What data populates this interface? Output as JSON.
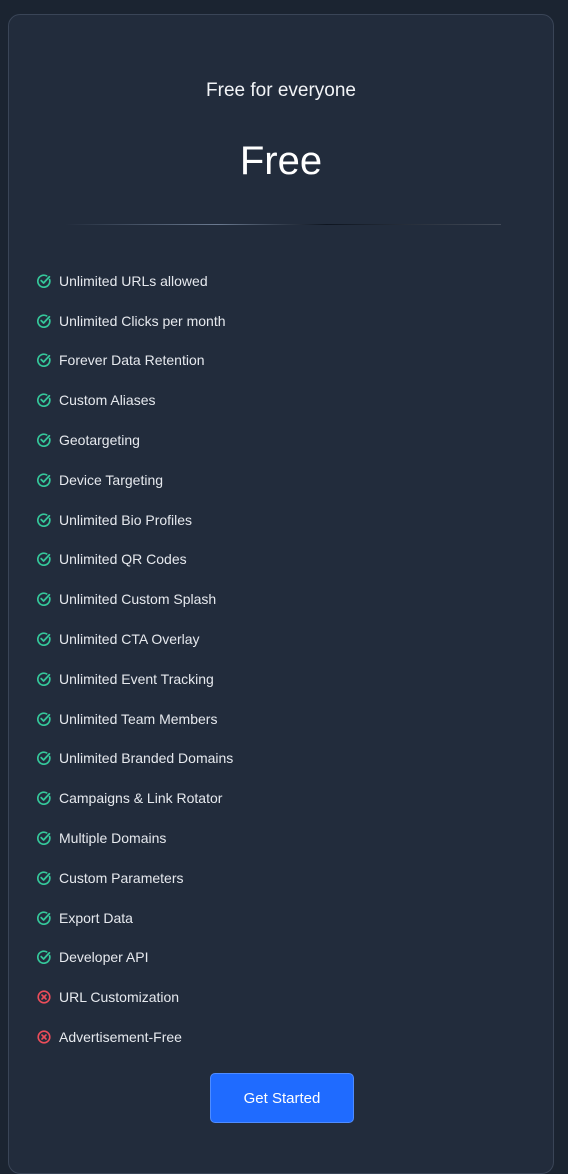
{
  "plan": {
    "subtitle": "Free for everyone",
    "price": "Free"
  },
  "colors": {
    "included": "#35c79a",
    "excluded": "#ec4d5a",
    "button": "#1f6bff"
  },
  "features": [
    {
      "label": "Unlimited URLs allowed",
      "included": true,
      "icon": "check-circle-icon"
    },
    {
      "label": "Unlimited Clicks per month",
      "included": true,
      "icon": "check-circle-icon"
    },
    {
      "label": "Forever Data Retention",
      "included": true,
      "icon": "check-circle-icon"
    },
    {
      "label": "Custom Aliases",
      "included": true,
      "icon": "check-circle-icon"
    },
    {
      "label": "Geotargeting",
      "included": true,
      "icon": "check-circle-icon"
    },
    {
      "label": "Device Targeting",
      "included": true,
      "icon": "check-circle-icon"
    },
    {
      "label": "Unlimited Bio Profiles",
      "included": true,
      "icon": "check-circle-icon"
    },
    {
      "label": "Unlimited QR Codes",
      "included": true,
      "icon": "check-circle-icon"
    },
    {
      "label": "Unlimited Custom Splash",
      "included": true,
      "icon": "check-circle-icon"
    },
    {
      "label": "Unlimited CTA Overlay",
      "included": true,
      "icon": "check-circle-icon"
    },
    {
      "label": "Unlimited Event Tracking",
      "included": true,
      "icon": "check-circle-icon"
    },
    {
      "label": "Unlimited Team Members",
      "included": true,
      "icon": "check-circle-icon"
    },
    {
      "label": "Unlimited Branded Domains",
      "included": true,
      "icon": "check-circle-icon"
    },
    {
      "label": "Campaigns & Link Rotator",
      "included": true,
      "icon": "check-circle-icon"
    },
    {
      "label": "Multiple Domains",
      "included": true,
      "icon": "check-circle-icon"
    },
    {
      "label": "Custom Parameters",
      "included": true,
      "icon": "check-circle-icon"
    },
    {
      "label": "Export Data",
      "included": true,
      "icon": "check-circle-icon"
    },
    {
      "label": "Developer API",
      "included": true,
      "icon": "check-circle-icon"
    },
    {
      "label": "URL Customization",
      "included": false,
      "icon": "x-circle-icon"
    },
    {
      "label": "Advertisement-Free",
      "included": false,
      "icon": "x-circle-icon"
    }
  ],
  "cta": {
    "label": "Get Started"
  }
}
